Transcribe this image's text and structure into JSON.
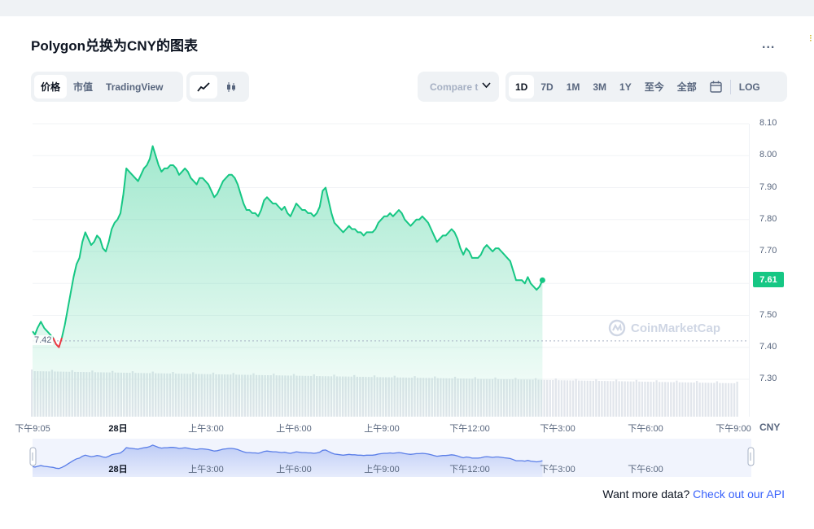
{
  "title": "Polygon兑换为CNY的图表",
  "more_label": "...",
  "view_tabs": [
    {
      "label": "价格",
      "active": true
    },
    {
      "label": "市值",
      "active": false
    },
    {
      "label": "TradingView",
      "active": false
    }
  ],
  "chart_type_icons": [
    {
      "icon": "line-chart-icon",
      "active": true
    },
    {
      "icon": "candlestick-icon",
      "active": false
    }
  ],
  "compare_label": "Compare t",
  "range_tabs": [
    {
      "label": "1D",
      "active": true
    },
    {
      "label": "7D",
      "active": false
    },
    {
      "label": "1M",
      "active": false
    },
    {
      "label": "3M",
      "active": false
    },
    {
      "label": "1Y",
      "active": false
    },
    {
      "label": "至今",
      "active": false
    },
    {
      "label": "全部",
      "active": false
    },
    {
      "label": "",
      "icon": "calendar-icon",
      "active": false
    },
    {
      "label": "LOG",
      "active": false
    }
  ],
  "current_price_label": "7.61",
  "baseline_label": "7.42",
  "unit_label": "CNY",
  "watermark": "CoinMarketCap",
  "footer": {
    "text": "Want more data?",
    "link": "Check out our API"
  },
  "colors": {
    "up": "#16c784",
    "down": "#ea3943",
    "accent": "#3861fb",
    "navigator": "#5a7ee8"
  },
  "chart_data": {
    "type": "line",
    "title": "Polygon兑换为CNY的图表",
    "xlabel": "",
    "ylabel": "CNY",
    "ylim": [
      7.22,
      8.1
    ],
    "yticks": [
      "8.10",
      "8.00",
      "7.90",
      "7.80",
      "7.70",
      "7.60",
      "7.50",
      "7.40",
      "7.30"
    ],
    "xticks": [
      {
        "label": "下午9:05",
        "t": 0,
        "bold": false
      },
      {
        "label": "28日",
        "t": 175,
        "bold": true
      },
      {
        "label": "上午3:00",
        "t": 355,
        "bold": false
      },
      {
        "label": "上午6:00",
        "t": 535,
        "bold": false
      },
      {
        "label": "上午9:00",
        "t": 715,
        "bold": false
      },
      {
        "label": "下午12:00",
        "t": 895,
        "bold": false
      },
      {
        "label": "下午3:00",
        "t": 1075,
        "bold": false
      },
      {
        "label": "下午6:00",
        "t": 1255,
        "bold": false
      },
      {
        "label": "下午9:00",
        "t": 1435,
        "bold": false
      }
    ],
    "navigator_ticks": [
      {
        "label": "28日",
        "t": 175,
        "bold": true
      },
      {
        "label": "上午3:00",
        "t": 355,
        "bold": false
      },
      {
        "label": "上午6:00",
        "t": 535,
        "bold": false
      },
      {
        "label": "上午9:00",
        "t": 715,
        "bold": false
      },
      {
        "label": "下午12:00",
        "t": 895,
        "bold": false
      },
      {
        "label": "下午3:00",
        "t": 1075,
        "bold": false
      },
      {
        "label": "下午6:00",
        "t": 1255,
        "bold": false
      }
    ],
    "series": [
      {
        "values": [
          [
            0,
            7.45
          ],
          [
            5,
            7.44
          ],
          [
            10,
            7.46
          ],
          [
            17,
            7.48
          ],
          [
            24,
            7.46
          ],
          [
            30,
            7.45
          ],
          [
            36,
            7.44
          ],
          [
            42,
            7.43
          ],
          [
            48,
            7.41
          ],
          [
            54,
            7.4
          ],
          [
            60,
            7.43
          ],
          [
            66,
            7.47
          ],
          [
            72,
            7.52
          ],
          [
            78,
            7.57
          ],
          [
            84,
            7.62
          ],
          [
            90,
            7.66
          ],
          [
            96,
            7.68
          ],
          [
            102,
            7.73
          ],
          [
            108,
            7.76
          ],
          [
            114,
            7.74
          ],
          [
            120,
            7.72
          ],
          [
            126,
            7.73
          ],
          [
            132,
            7.75
          ],
          [
            138,
            7.74
          ],
          [
            144,
            7.71
          ],
          [
            150,
            7.7
          ],
          [
            156,
            7.73
          ],
          [
            162,
            7.77
          ],
          [
            168,
            7.79
          ],
          [
            174,
            7.8
          ],
          [
            180,
            7.82
          ],
          [
            186,
            7.88
          ],
          [
            192,
            7.96
          ],
          [
            198,
            7.95
          ],
          [
            204,
            7.94
          ],
          [
            210,
            7.93
          ],
          [
            216,
            7.92
          ],
          [
            222,
            7.94
          ],
          [
            228,
            7.96
          ],
          [
            234,
            7.97
          ],
          [
            240,
            7.99
          ],
          [
            246,
            8.03
          ],
          [
            252,
            8.0
          ],
          [
            258,
            7.97
          ],
          [
            264,
            7.95
          ],
          [
            270,
            7.96
          ],
          [
            276,
            7.96
          ],
          [
            282,
            7.97
          ],
          [
            288,
            7.97
          ],
          [
            294,
            7.96
          ],
          [
            300,
            7.94
          ],
          [
            306,
            7.95
          ],
          [
            312,
            7.96
          ],
          [
            318,
            7.95
          ],
          [
            324,
            7.93
          ],
          [
            330,
            7.92
          ],
          [
            336,
            7.91
          ],
          [
            342,
            7.93
          ],
          [
            348,
            7.93
          ],
          [
            354,
            7.92
          ],
          [
            360,
            7.91
          ],
          [
            366,
            7.89
          ],
          [
            372,
            7.87
          ],
          [
            378,
            7.88
          ],
          [
            384,
            7.9
          ],
          [
            390,
            7.92
          ],
          [
            396,
            7.93
          ],
          [
            402,
            7.94
          ],
          [
            408,
            7.94
          ],
          [
            414,
            7.93
          ],
          [
            420,
            7.91
          ],
          [
            426,
            7.88
          ],
          [
            432,
            7.85
          ],
          [
            438,
            7.83
          ],
          [
            444,
            7.83
          ],
          [
            450,
            7.82
          ],
          [
            456,
            7.82
          ],
          [
            462,
            7.81
          ],
          [
            468,
            7.83
          ],
          [
            474,
            7.86
          ],
          [
            480,
            7.87
          ],
          [
            486,
            7.86
          ],
          [
            492,
            7.85
          ],
          [
            498,
            7.85
          ],
          [
            504,
            7.84
          ],
          [
            510,
            7.83
          ],
          [
            516,
            7.84
          ],
          [
            522,
            7.82
          ],
          [
            528,
            7.81
          ],
          [
            534,
            7.83
          ],
          [
            540,
            7.85
          ],
          [
            546,
            7.84
          ],
          [
            552,
            7.83
          ],
          [
            558,
            7.83
          ],
          [
            564,
            7.82
          ],
          [
            570,
            7.82
          ],
          [
            576,
            7.81
          ],
          [
            582,
            7.82
          ],
          [
            588,
            7.84
          ],
          [
            594,
            7.89
          ],
          [
            600,
            7.9
          ],
          [
            606,
            7.86
          ],
          [
            612,
            7.82
          ],
          [
            618,
            7.79
          ],
          [
            624,
            7.78
          ],
          [
            630,
            7.77
          ],
          [
            636,
            7.76
          ],
          [
            642,
            7.77
          ],
          [
            648,
            7.78
          ],
          [
            654,
            7.77
          ],
          [
            660,
            7.77
          ],
          [
            666,
            7.76
          ],
          [
            672,
            7.76
          ],
          [
            678,
            7.75
          ],
          [
            684,
            7.76
          ],
          [
            690,
            7.76
          ],
          [
            696,
            7.76
          ],
          [
            702,
            7.77
          ],
          [
            708,
            7.79
          ],
          [
            714,
            7.8
          ],
          [
            720,
            7.81
          ],
          [
            726,
            7.81
          ],
          [
            732,
            7.82
          ],
          [
            738,
            7.81
          ],
          [
            744,
            7.82
          ],
          [
            750,
            7.83
          ],
          [
            756,
            7.82
          ],
          [
            762,
            7.8
          ],
          [
            768,
            7.79
          ],
          [
            774,
            7.78
          ],
          [
            780,
            7.79
          ],
          [
            786,
            7.8
          ],
          [
            792,
            7.8
          ],
          [
            798,
            7.81
          ],
          [
            804,
            7.8
          ],
          [
            810,
            7.79
          ],
          [
            816,
            7.77
          ],
          [
            822,
            7.75
          ],
          [
            828,
            7.73
          ],
          [
            834,
            7.74
          ],
          [
            840,
            7.75
          ],
          [
            846,
            7.75
          ],
          [
            852,
            7.76
          ],
          [
            858,
            7.77
          ],
          [
            864,
            7.76
          ],
          [
            870,
            7.74
          ],
          [
            876,
            7.71
          ],
          [
            882,
            7.69
          ],
          [
            888,
            7.71
          ],
          [
            894,
            7.7
          ],
          [
            900,
            7.68
          ],
          [
            906,
            7.68
          ],
          [
            912,
            7.68
          ],
          [
            918,
            7.69
          ],
          [
            924,
            7.71
          ],
          [
            930,
            7.72
          ],
          [
            936,
            7.71
          ],
          [
            942,
            7.7
          ],
          [
            948,
            7.71
          ],
          [
            954,
            7.71
          ],
          [
            960,
            7.7
          ],
          [
            966,
            7.69
          ],
          [
            972,
            7.68
          ],
          [
            978,
            7.67
          ],
          [
            984,
            7.64
          ],
          [
            990,
            7.61
          ],
          [
            996,
            7.61
          ],
          [
            1002,
            7.61
          ],
          [
            1008,
            7.6
          ],
          [
            1014,
            7.62
          ],
          [
            1020,
            7.6
          ],
          [
            1026,
            7.59
          ],
          [
            1032,
            7.58
          ],
          [
            1038,
            7.59
          ],
          [
            1044,
            7.61
          ]
        ]
      }
    ],
    "baseline": 7.42,
    "current": 7.61,
    "volume_bars": 246
  }
}
